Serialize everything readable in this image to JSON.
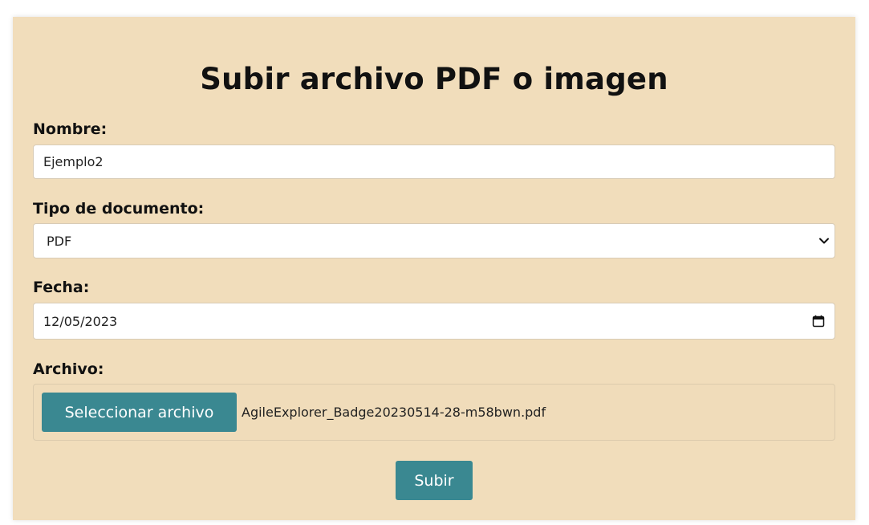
{
  "form": {
    "title": "Subir archivo PDF o imagen",
    "name_label": "Nombre:",
    "name_value": "Ejemplo2",
    "doc_type_label": "Tipo de documento:",
    "doc_type_selected": "PDF",
    "date_label": "Fecha:",
    "date_value": "12/05/2023",
    "file_label": "Archivo:",
    "file_button_label": "Seleccionar archivo",
    "file_name": "AgileExplorer_Badge20230514-28-m58bwn.pdf",
    "submit_label": "Subir"
  },
  "icons": {
    "select_arrow": "chevron-down-icon",
    "date_picker": "calendar-icon"
  },
  "colors": {
    "panel_background": "#f1ddbb",
    "button_background": "#3a8891",
    "button_text": "#ffffff"
  }
}
